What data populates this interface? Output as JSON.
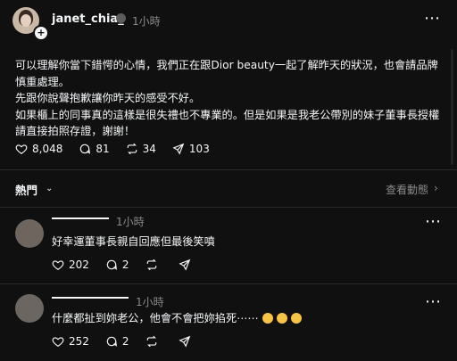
{
  "post": {
    "username": "janet_chia_",
    "time": "1小時",
    "more_label": "⋯",
    "text": "可以理解你當下錯愕的心情，我們正在跟Dior beauty一起了解昨天的狀況，也會請品牌慎重處理。\n先跟你說聲抱歉讓你昨天的感受不好。\n如果櫃上的同事真的這樣是很失禮也不專業的。但是如果是我老公帶別的妹子董事長授權請直接拍照存證，謝謝！",
    "likes": "8,048",
    "comments": "81",
    "reposts": "34",
    "shares": "103"
  },
  "replies_header": {
    "sort_label": "熱門",
    "activity_label": "查看動態",
    "activity_arrow": "›"
  },
  "replies": [
    {
      "time": "1小時",
      "text": "好幸運董事長親自回應但最後笑噴",
      "likes": "202",
      "comments": "2",
      "more_label": "⋯"
    },
    {
      "time": "1小時",
      "text": "什麼都扯到妳老公，他會不會把妳掐死⋯⋯",
      "likes": "252",
      "comments": "2",
      "more_label": "⋯"
    }
  ],
  "colors": {
    "background": "#101010",
    "text": "#f3f5f7",
    "muted": "#8a8a8a",
    "divider": "#2a2a2a"
  },
  "icons": [
    "heart-icon",
    "comment-icon",
    "repost-icon",
    "share-icon",
    "verified-badge-icon",
    "plus-icon",
    "more-icon",
    "chevron-down-icon",
    "laughing-emoji-icon"
  ]
}
